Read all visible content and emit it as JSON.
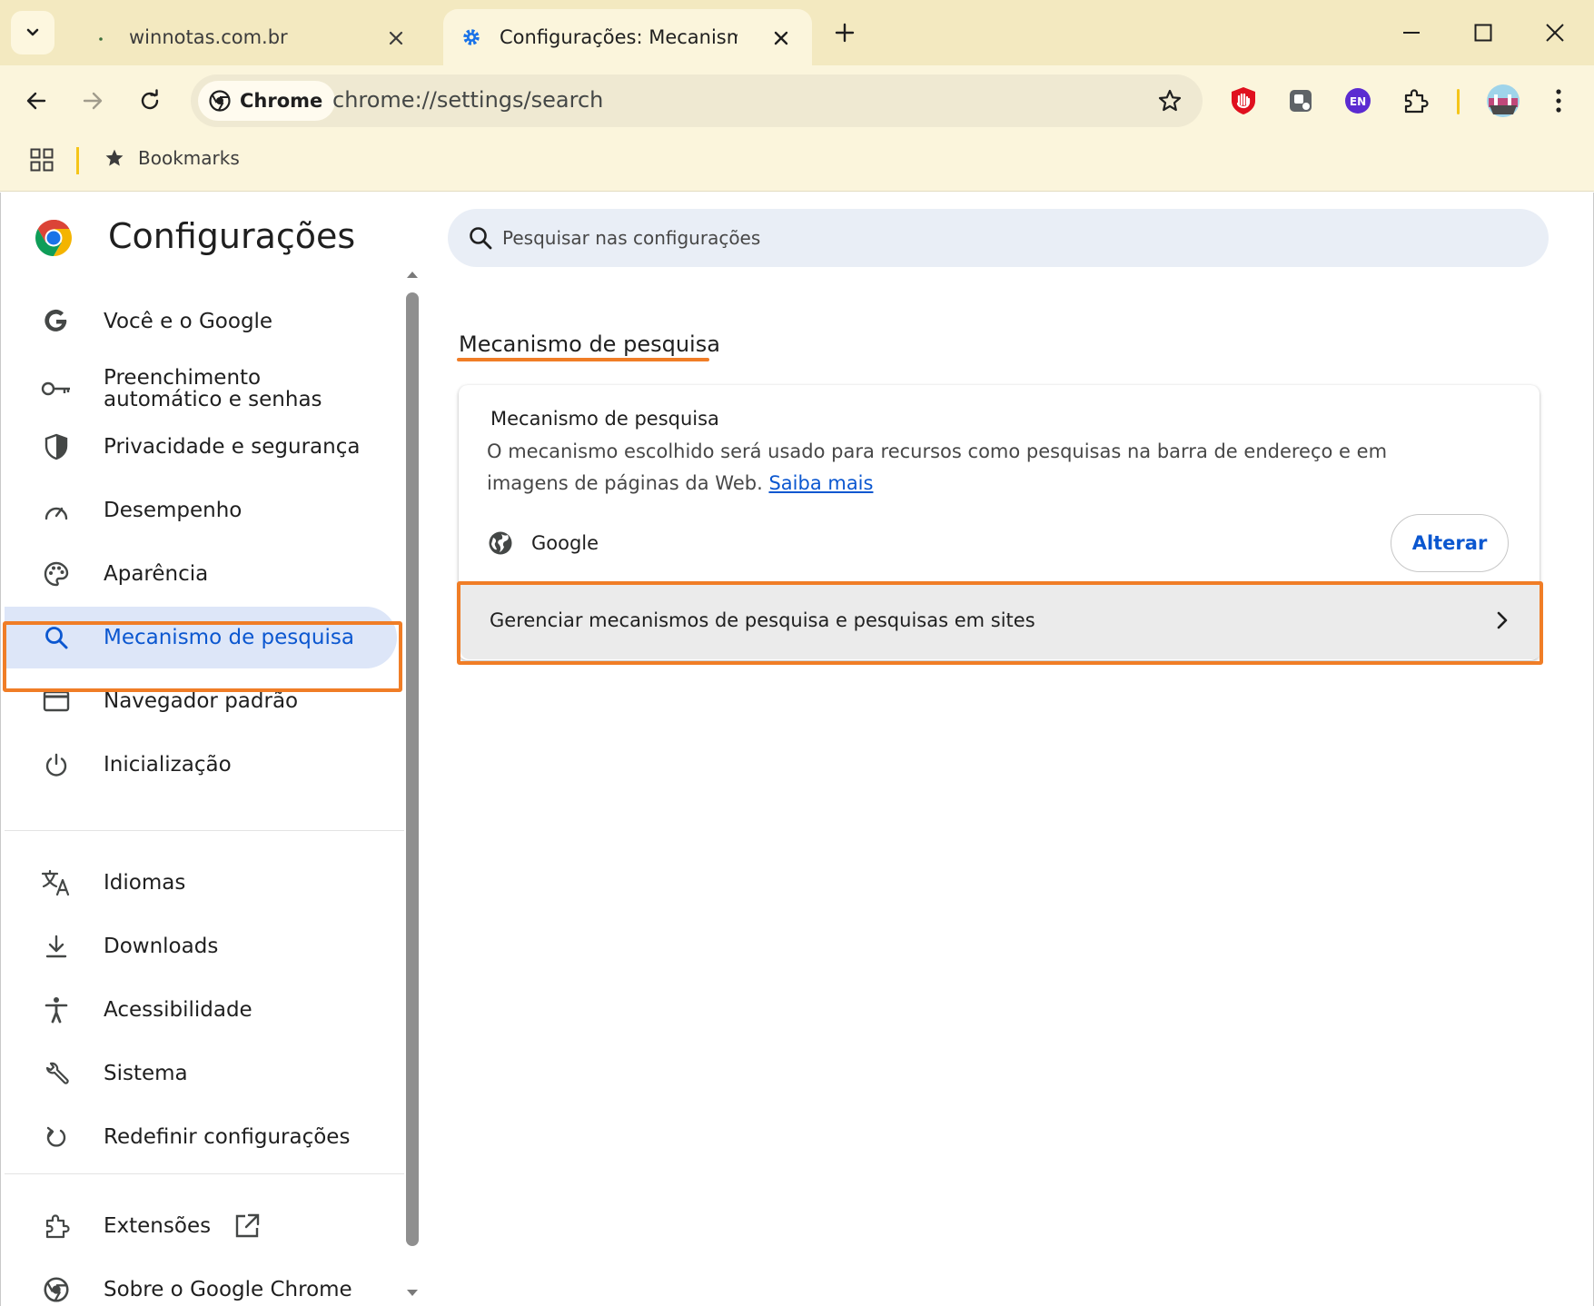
{
  "browser": {
    "tabs": [
      {
        "title": "winnotas.com.br",
        "active": false,
        "favicon": "dot-favicon"
      },
      {
        "title": "Configurações: Mecanismo de p",
        "active": true,
        "favicon": "gear-icon"
      }
    ],
    "address_bar": {
      "chip_label": "Chrome",
      "url": "chrome://settings/search"
    },
    "bookmarks_bar": {
      "bookmarks_label": "Bookmarks"
    },
    "extensions": [
      "ublock-icon",
      "extension-tile-icon",
      "language-en-icon",
      "puzzle-icon"
    ],
    "extension_en_label": "EN"
  },
  "settings": {
    "title": "Configurações",
    "search": {
      "placeholder": "Pesquisar nas configurações"
    },
    "nav": [
      {
        "label": "Você e o Google",
        "icon": "google-g-icon",
        "active": false
      },
      {
        "label": "Preenchimento automático e senhas",
        "icon": "key-icon",
        "active": false
      },
      {
        "label": "Privacidade e segurança",
        "icon": "shield-icon",
        "active": false
      },
      {
        "label": "Desempenho",
        "icon": "speedometer-icon",
        "active": false
      },
      {
        "label": "Aparência",
        "icon": "palette-icon",
        "active": false
      },
      {
        "label": "Mecanismo de pesquisa",
        "icon": "search-icon",
        "active": true
      },
      {
        "label": "Navegador padrão",
        "icon": "browser-window-icon",
        "active": false
      },
      {
        "label": "Inicialização",
        "icon": "power-icon",
        "active": false
      },
      {
        "label": "Idiomas",
        "icon": "translate-icon",
        "active": false
      },
      {
        "label": "Downloads",
        "icon": "download-icon",
        "active": false
      },
      {
        "label": "Acessibilidade",
        "icon": "accessibility-icon",
        "active": false
      },
      {
        "label": "Sistema",
        "icon": "wrench-icon",
        "active": false
      },
      {
        "label": "Redefinir configurações",
        "icon": "reset-icon",
        "active": false
      },
      {
        "label": "Extensões",
        "icon": "puzzle-icon",
        "active": false
      },
      {
        "label": "Sobre o Google Chrome",
        "icon": "chrome-icon",
        "active": false
      }
    ],
    "section": {
      "title": "Mecanismo de pesquisa",
      "card_title": "Mecanismo de pesquisa",
      "description": "O mecanismo escolhido será usado para recursos como pesquisas na barra de endereço e em imagens de páginas da Web.",
      "learn_more": "Saiba mais",
      "engine_name": "Google",
      "change_button": "Alterar",
      "manage_label": "Gerenciar mecanismos de pesquisa e pesquisas em sites"
    }
  },
  "colors": {
    "highlight": "#f07d26",
    "accent": "#0b57d0",
    "frame": "#f3e9c0",
    "toolbar": "#fbf5dc"
  }
}
